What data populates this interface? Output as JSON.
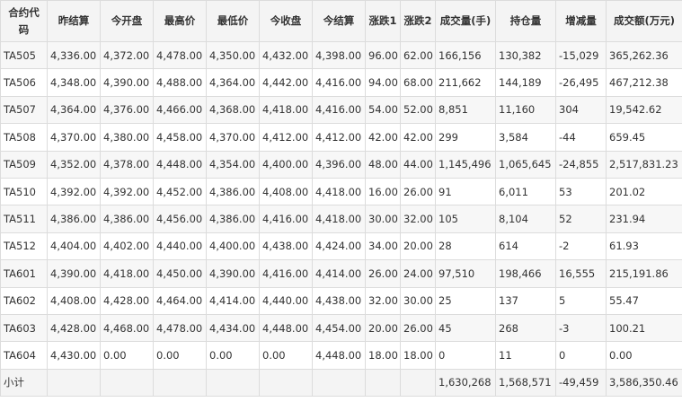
{
  "headers": [
    "合约代码",
    "昨结算",
    "今开盘",
    "最高价",
    "最低价",
    "今收盘",
    "今结算",
    "涨跌1",
    "涨跌2",
    "成交量(手)",
    "持仓量",
    "增减量",
    "成交额(万元)"
  ],
  "rows": [
    [
      "TA505",
      "4,336.00",
      "4,372.00",
      "4,478.00",
      "4,350.00",
      "4,432.00",
      "4,398.00",
      "96.00",
      "62.00",
      "166,156",
      "130,382",
      "-15,029",
      "365,262.36"
    ],
    [
      "TA506",
      "4,348.00",
      "4,390.00",
      "4,488.00",
      "4,364.00",
      "4,442.00",
      "4,416.00",
      "94.00",
      "68.00",
      "211,662",
      "144,189",
      "-26,495",
      "467,212.38"
    ],
    [
      "TA507",
      "4,364.00",
      "4,376.00",
      "4,466.00",
      "4,368.00",
      "4,418.00",
      "4,416.00",
      "54.00",
      "52.00",
      "8,851",
      "11,160",
      "304",
      "19,542.62"
    ],
    [
      "TA508",
      "4,370.00",
      "4,380.00",
      "4,458.00",
      "4,370.00",
      "4,412.00",
      "4,412.00",
      "42.00",
      "42.00",
      "299",
      "3,584",
      "-44",
      "659.45"
    ],
    [
      "TA509",
      "4,352.00",
      "4,378.00",
      "4,448.00",
      "4,354.00",
      "4,400.00",
      "4,396.00",
      "48.00",
      "44.00",
      "1,145,496",
      "1,065,645",
      "-24,855",
      "2,517,831.23"
    ],
    [
      "TA510",
      "4,392.00",
      "4,392.00",
      "4,452.00",
      "4,386.00",
      "4,408.00",
      "4,418.00",
      "16.00",
      "26.00",
      "91",
      "6,011",
      "53",
      "201.02"
    ],
    [
      "TA511",
      "4,386.00",
      "4,386.00",
      "4,456.00",
      "4,386.00",
      "4,416.00",
      "4,418.00",
      "30.00",
      "32.00",
      "105",
      "8,104",
      "52",
      "231.94"
    ],
    [
      "TA512",
      "4,404.00",
      "4,402.00",
      "4,440.00",
      "4,400.00",
      "4,438.00",
      "4,424.00",
      "34.00",
      "20.00",
      "28",
      "614",
      "-2",
      "61.93"
    ],
    [
      "TA601",
      "4,390.00",
      "4,418.00",
      "4,450.00",
      "4,390.00",
      "4,416.00",
      "4,414.00",
      "26.00",
      "24.00",
      "97,510",
      "198,466",
      "16,555",
      "215,191.86"
    ],
    [
      "TA602",
      "4,408.00",
      "4,428.00",
      "4,464.00",
      "4,414.00",
      "4,440.00",
      "4,438.00",
      "32.00",
      "30.00",
      "25",
      "137",
      "5",
      "55.47"
    ],
    [
      "TA603",
      "4,428.00",
      "4,468.00",
      "4,478.00",
      "4,434.00",
      "4,448.00",
      "4,454.00",
      "20.00",
      "26.00",
      "45",
      "268",
      "-3",
      "100.21"
    ],
    [
      "TA604",
      "4,430.00",
      "0.00",
      "0.00",
      "0.00",
      "0.00",
      "4,448.00",
      "18.00",
      "18.00",
      "0",
      "11",
      "0",
      "0.00"
    ],
    [
      "小计",
      "",
      "",
      "",
      "",
      "",
      "",
      "",
      "",
      "1,630,268",
      "1,568,571",
      "-49,459",
      "3,586,350.46"
    ]
  ]
}
